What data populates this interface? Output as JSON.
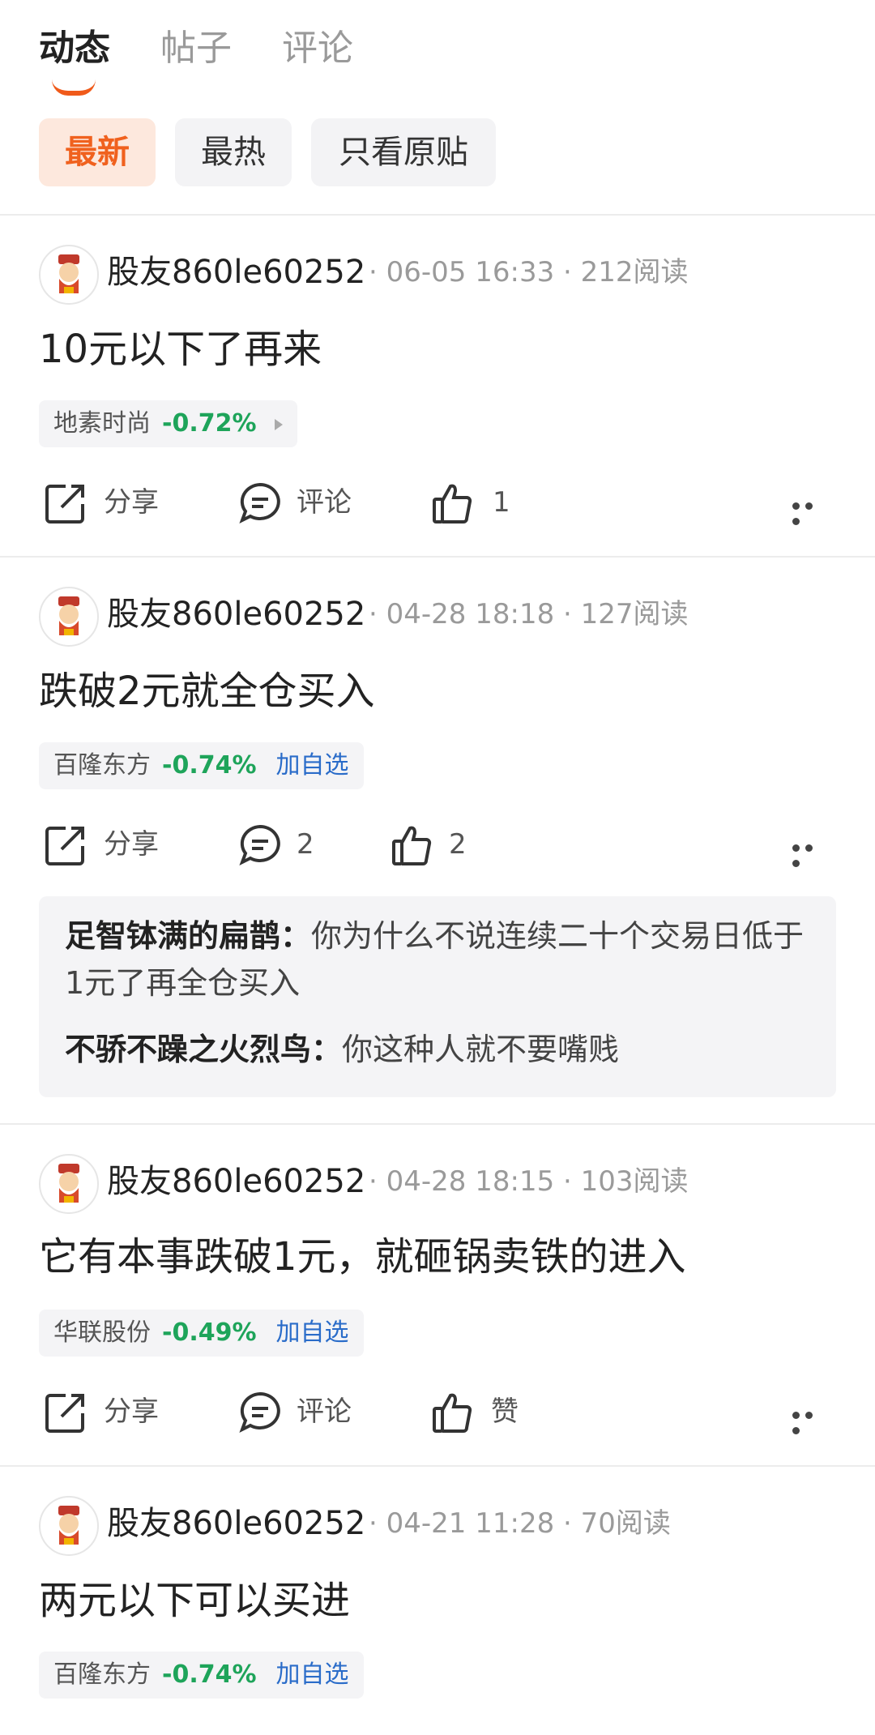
{
  "tabs": [
    {
      "label": "动态",
      "active": true
    },
    {
      "label": "帖子",
      "active": false
    },
    {
      "label": "评论",
      "active": false
    }
  ],
  "filters": [
    {
      "label": "最新",
      "active": true
    },
    {
      "label": "最热",
      "active": false
    },
    {
      "label": "只看原贴",
      "active": false
    }
  ],
  "colors": {
    "accent": "#f0611e",
    "up_down_green": "#1ea45a",
    "link_blue": "#2a6cc9"
  },
  "posts": [
    {
      "author": "股友860le60252",
      "date": "06-05 16:33",
      "reads": "212阅读",
      "content": "10元以下了再来",
      "stock": {
        "name": "地素时尚",
        "change": "-0.72%"
      },
      "actions": {
        "share": "分享",
        "comment": "评论",
        "like": "1"
      }
    },
    {
      "author": "股友860le60252",
      "date": "04-28 18:18",
      "reads": "127阅读",
      "content": "跌破2元就全仓买入",
      "stock": {
        "name": "百隆东方",
        "change": "-0.74%",
        "add": "加自选"
      },
      "actions": {
        "share": "分享",
        "comment": "2",
        "like": "2"
      },
      "comments": [
        {
          "user": "足智钵满的扁鹊：",
          "text": "你为什么不说连续二十个交易日低于1元了再全仓买入"
        },
        {
          "user": "不骄不躁之火烈鸟：",
          "text": "你这种人就不要嘴贱"
        }
      ]
    },
    {
      "author": "股友860le60252",
      "date": "04-28 18:15",
      "reads": "103阅读",
      "content": "它有本事跌破1元，就砸锅卖铁的进入",
      "stock": {
        "name": "华联股份",
        "change": "-0.49%",
        "add": "加自选"
      },
      "actions": {
        "share": "分享",
        "comment": "评论",
        "like": "赞"
      }
    },
    {
      "author": "股友860le60252",
      "date": "04-21 11:28",
      "reads": "70阅读",
      "content": "两元以下可以买进",
      "stock": {
        "name": "百隆东方",
        "change": "-0.74%",
        "add": "加自选"
      }
    }
  ]
}
